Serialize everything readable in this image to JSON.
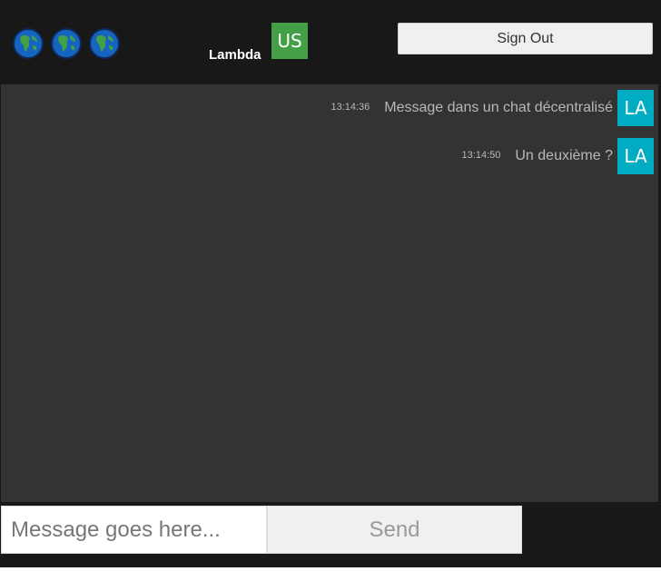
{
  "header": {
    "globes": [
      {
        "icon": "globe-icon"
      },
      {
        "icon": "globe-icon"
      },
      {
        "icon": "globe-icon"
      }
    ],
    "username": "Lambda",
    "user_avatar": "US",
    "sign_out_label": "Sign Out"
  },
  "messages": [
    {
      "time": "13:14:36",
      "text": "Message dans un chat décentralisé",
      "avatar": "LA"
    },
    {
      "time": "13:14:50",
      "text": "Un deuxième ?",
      "avatar": "LA"
    }
  ],
  "composer": {
    "input_placeholder": "Message goes here...",
    "input_value": "",
    "send_label": "Send"
  },
  "colors": {
    "background": "#181818",
    "chat_panel": "#333333",
    "user_avatar": "#43a047",
    "message_avatar": "#00acc1"
  }
}
